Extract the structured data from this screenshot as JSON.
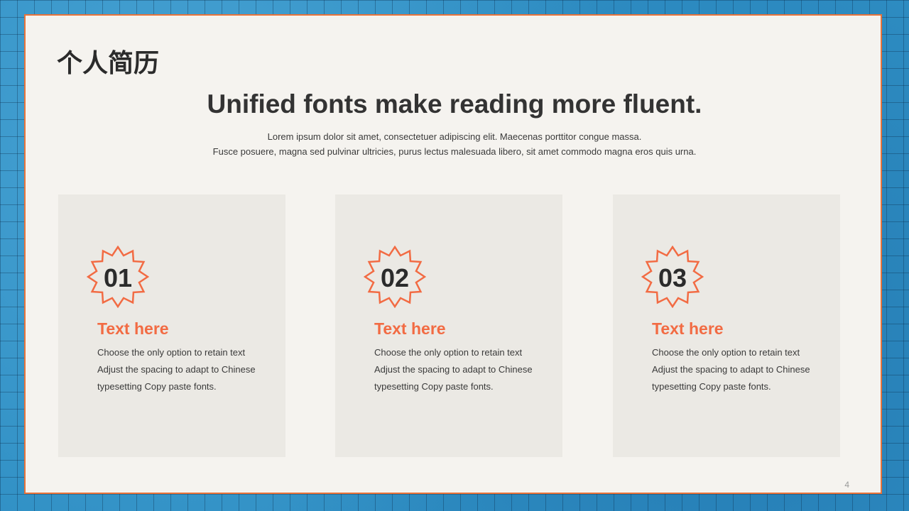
{
  "slide": {
    "heading": "个人简历",
    "subtitle": "Unified fonts make reading more fluent.",
    "description": [
      "Lorem ipsum dolor sit amet, consectetuer adipiscing elit. Maecenas porttitor congue massa.",
      "Fusce posuere, magna sed pulvinar ultricies, purus lectus malesuada libero, sit amet commodo magna eros quis urna."
    ],
    "page_number": "4"
  },
  "cards": [
    {
      "number": "01",
      "title": "Text here",
      "lines": [
        "Choose the only option to retain text",
        "Adjust the spacing to adapt to Chinese",
        "typesetting Copy paste fonts."
      ]
    },
    {
      "number": "02",
      "title": "Text here",
      "lines": [
        "Choose the only option to retain text",
        "Adjust the spacing to adapt to Chinese",
        "typesetting Copy paste fonts."
      ]
    },
    {
      "number": "03",
      "title": "Text here",
      "lines": [
        "Choose the only option to retain text",
        "Adjust the spacing to adapt to Chinese",
        "typesetting Copy paste fonts."
      ]
    }
  ],
  "colors": {
    "accent": "#f26b43",
    "border": "#e8733a",
    "background": "#2f8fc4",
    "slide": "#f5f3ef",
    "card": "#ebe9e4",
    "text": "#2b2b2b"
  },
  "icons": {
    "badge": "starburst-badge-icon"
  }
}
